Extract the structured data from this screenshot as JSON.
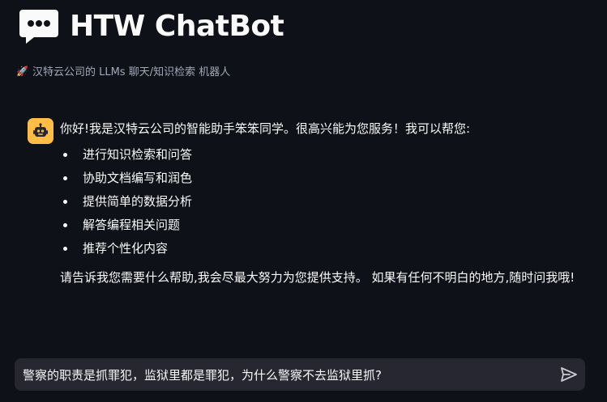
{
  "app": {
    "title": "HTW ChatBot",
    "subtitle": "汉特云公司的 LLMs 聊天/知识检索 机器人",
    "title_icon": "chat-bubble-icon",
    "subtitle_icon": "rocket-icon"
  },
  "messages": [
    {
      "role": "assistant",
      "avatar_icon": "robot-icon",
      "intro": "你好!我是汉特云公司的智能助手笨笨同学。很高兴能为您服务！我可以帮您:",
      "bullets": [
        "进行知识检索和问答",
        "协助文档编写和润色",
        "提供简单的数据分析",
        "解答编程相关问题",
        "推荐个性化内容"
      ],
      "closing": "请告诉我您需要什么帮助,我会尽最大努力为您提供支持。 如果有任何不明白的地方,随时问我哦!"
    }
  ],
  "chat_input": {
    "value": "警察的职责是抓罪犯，监狱里都是罪犯，为什么警察不去监狱里抓?",
    "send_icon": "send-icon"
  },
  "colors": {
    "background": "#0e1117",
    "avatar": "#ffbd45",
    "input_background": "#262730",
    "subtitle_text": "#a3a8b8"
  }
}
